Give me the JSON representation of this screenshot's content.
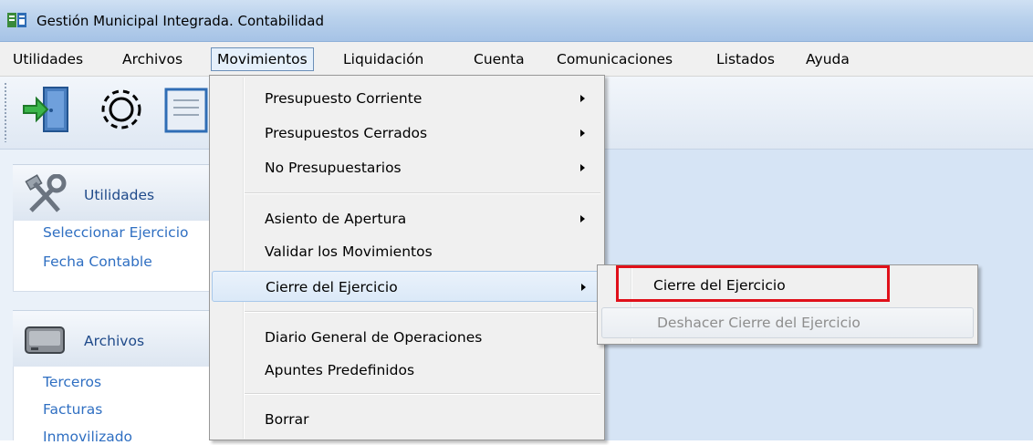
{
  "window": {
    "title": "Gestión Municipal Integrada. Contabilidad"
  },
  "menubar": {
    "items": [
      "Utilidades",
      "Archivos",
      "Movimientos",
      "Liquidación",
      "Cuenta",
      "Comunicaciones",
      "Listados",
      "Ayuda"
    ],
    "active": "Movimientos"
  },
  "toolbar": {
    "buttons": [
      "exit-door-icon",
      "gear-icon",
      "notepad-icon"
    ]
  },
  "sidebar": {
    "panels": [
      {
        "title": "Utilidades",
        "icon": "tools-icon",
        "links": [
          "Seleccionar Ejercicio",
          "Fecha Contable"
        ]
      },
      {
        "title": "Archivos",
        "icon": "drive-icon",
        "links": [
          "Terceros",
          "Facturas",
          "Inmovilizado"
        ]
      }
    ]
  },
  "dropdown": {
    "items": [
      {
        "label": "Presupuesto Corriente",
        "submenu": true
      },
      {
        "label": "Presupuestos Cerrados",
        "submenu": true
      },
      {
        "label": "No Presupuestarios",
        "submenu": true
      },
      {
        "label": "Asiento de Apertura",
        "submenu": true
      },
      {
        "label": "Validar los Movimientos",
        "submenu": false
      },
      {
        "label": "Cierre del Ejercicio",
        "submenu": true,
        "highlighted": true
      },
      {
        "label": "Diario General de Operaciones",
        "submenu": false
      },
      {
        "label": "Apuntes Predefinidos",
        "submenu": false
      },
      {
        "label": "Borrar",
        "submenu": false
      }
    ]
  },
  "submenu": {
    "items": [
      {
        "label": "Cierre del Ejercicio",
        "enabled": true
      },
      {
        "label": "Deshacer Cierre del Ejercicio",
        "enabled": false
      }
    ]
  },
  "colors": {
    "highlight_border": "#e0101a",
    "link": "#2f6fc2",
    "content_bg": "#d6e4f5"
  }
}
